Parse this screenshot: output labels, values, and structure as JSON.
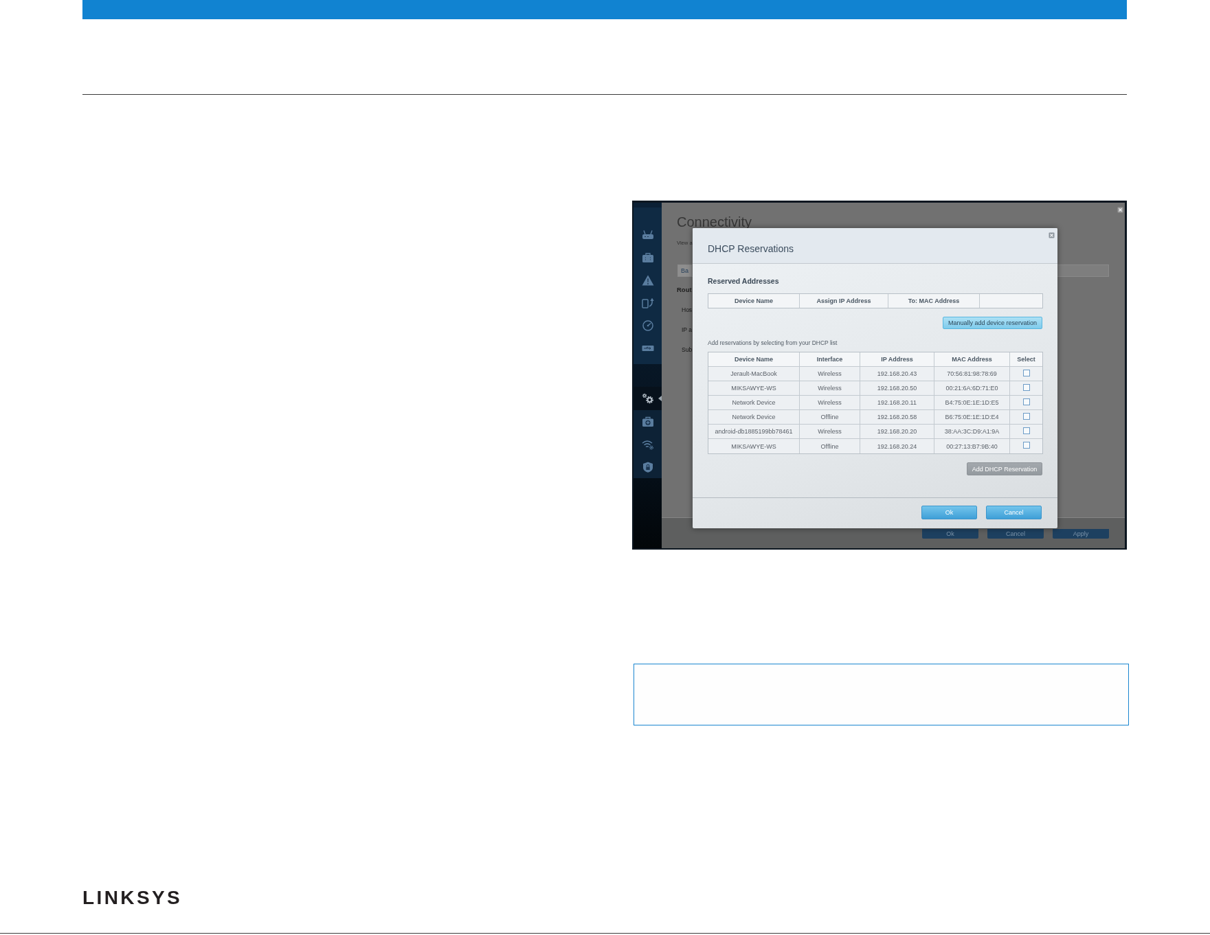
{
  "screenshot": {
    "sidebar": {
      "items": [
        {
          "selected": false
        },
        {
          "selected": false
        },
        {
          "selected": false
        },
        {
          "selected": false
        },
        {
          "selected": false
        },
        {
          "selected": false
        },
        {
          "selected": true
        },
        {
          "selected": false
        },
        {
          "selected": false
        },
        {
          "selected": false
        }
      ]
    },
    "background_page": {
      "title": "Connectivity",
      "subtitle": "View a",
      "tab": "Ba",
      "section_title": "Rout",
      "field_labels": [
        "Hos",
        "IP a",
        "Sub"
      ],
      "buttons": [
        "Ok",
        "Cancel",
        "Apply"
      ]
    },
    "dialog": {
      "title": "DHCP Reservations",
      "reserved_addresses": {
        "heading": "Reserved Addresses",
        "columns": [
          "Device Name",
          "Assign IP Address",
          "To: MAC Address"
        ],
        "manual_add_button": "Manually add device reservation"
      },
      "hint": "Add reservations by selecting from your DHCP list",
      "dhcp_list": {
        "columns": [
          "Device Name",
          "Interface",
          "IP Address",
          "MAC Address",
          "Select"
        ],
        "rows": [
          {
            "device_name": "Jerault-MacBook",
            "interface": "Wireless",
            "ip_address": "192.168.20.43",
            "mac_address": "70:56:81:98:78:69",
            "checked": false
          },
          {
            "device_name": "MIKSAWYE-WS",
            "interface": "Wireless",
            "ip_address": "192.168.20.50",
            "mac_address": "00:21:6A:6D:71:E0",
            "checked": false
          },
          {
            "device_name": "Network Device",
            "interface": "Wireless",
            "ip_address": "192.168.20.11",
            "mac_address": "B4:75:0E:1E:1D:E5",
            "checked": false
          },
          {
            "device_name": "Network Device",
            "interface": "Offline",
            "ip_address": "192.168.20.58",
            "mac_address": "B6:75:0E:1E:1D:E4",
            "checked": false
          },
          {
            "device_name": "android-db1885199bb78461",
            "interface": "Wireless",
            "ip_address": "192.168.20.20",
            "mac_address": "38:AA:3C:D9:A1:9A",
            "checked": false
          },
          {
            "device_name": "MIKSAWYE-WS",
            "interface": "Offline",
            "ip_address": "192.168.20.24",
            "mac_address": "00:27:13:B7:9B:40",
            "checked": false
          }
        ]
      },
      "add_button": {
        "label": "Add DHCP Reservation",
        "disabled": true
      },
      "buttons": [
        "Ok",
        "Cancel"
      ]
    }
  },
  "footer": {
    "logo": "LINKSYS"
  }
}
